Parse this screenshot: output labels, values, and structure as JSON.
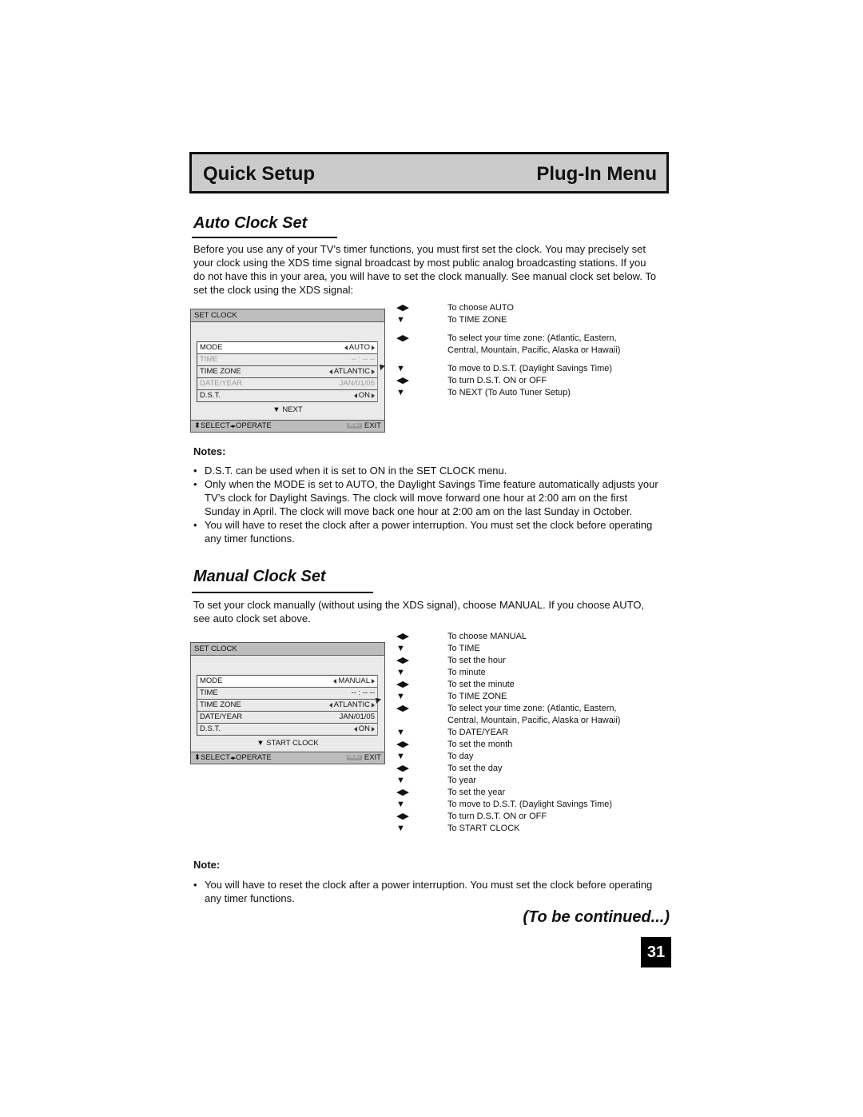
{
  "header": {
    "left_title": "Quick Setup",
    "right_title": "Plug-In Menu"
  },
  "auto_section": {
    "title": "Auto Clock Set",
    "intro": "Before you use any of your TV’s timer functions, you must first set the clock. You may precisely set your clock using the XDS time signal broadcast by most public analog broadcasting stations. If you do not have this in your area, you will have to set the clock manually. See manual clock set below. To set the clock using the XDS signal:",
    "menu": {
      "title": "SET CLOCK",
      "rows": [
        {
          "label": "MODE",
          "value": "AUTO",
          "arrows": true,
          "state": "highlight"
        },
        {
          "label": "TIME",
          "value": "-- : -- --",
          "arrows": false,
          "state": "dim"
        },
        {
          "label": "TIME ZONE",
          "value": "ATLANTIC",
          "arrows": true,
          "state": "normal"
        },
        {
          "label": "DATE/YEAR",
          "value": "JAN/01/05",
          "arrows": false,
          "state": "dim"
        },
        {
          "label": "D.S.T.",
          "value": "ON",
          "arrows": true,
          "state": "normal"
        }
      ],
      "next": "▼ NEXT",
      "footer_left": "SELECT",
      "footer_mid": "OPERATE",
      "footer_key": "MENU",
      "footer_right": "EXIT"
    },
    "instructions": [
      {
        "key": "◀▶",
        "text": "To choose AUTO"
      },
      {
        "key": "▼",
        "text": "To TIME ZONE",
        "gap_after": true
      },
      {
        "key": "◀▶",
        "text": "To select your time zone: (Atlantic, Eastern, Central, Mountain, Pacific, Alaska or Hawaii)",
        "gap_after": true
      },
      {
        "key": "▼",
        "text": "To move to D.S.T. (Daylight Savings Time)"
      },
      {
        "key": "◀▶",
        "text": "To turn D.S.T. ON or OFF"
      },
      {
        "key": "▼",
        "text": "To NEXT (To Auto Tuner Setup)"
      }
    ],
    "notes_label": "Notes:",
    "notes": [
      "D.S.T. can be used when it is set to ON in the SET CLOCK menu.",
      "Only when the MODE is set to AUTO, the Daylight Savings Time feature automatically adjusts your TV’s clock for Daylight Savings. The clock will move forward one hour at 2:00 am on the first Sunday in April. The clock will move back one hour at 2:00 am on the last Sunday in October.",
      "You will have to reset the clock after a power interruption. You must set the clock before operating any timer functions."
    ]
  },
  "manual_section": {
    "title": "Manual Clock Set",
    "intro": "To set your clock manually (without using the XDS signal), choose MANUAL. If you choose AUTO, see auto clock set above.",
    "menu": {
      "title": "SET CLOCK",
      "rows": [
        {
          "label": "MODE",
          "value": "MANUAL",
          "arrows": true,
          "state": "highlight"
        },
        {
          "label": "TIME",
          "value": "-- : -- --",
          "arrows": false,
          "state": "normal"
        },
        {
          "label": "TIME ZONE",
          "value": "ATLANTIC",
          "arrows": true,
          "state": "normal"
        },
        {
          "label": "DATE/YEAR",
          "value": "JAN/01/05",
          "arrows": false,
          "state": "normal"
        },
        {
          "label": "D.S.T.",
          "value": "ON",
          "arrows": true,
          "state": "normal"
        }
      ],
      "next": "▼ START CLOCK",
      "footer_left": "SELECT",
      "footer_mid": "OPERATE",
      "footer_key": "MENU",
      "footer_right": "EXIT"
    },
    "instructions": [
      {
        "key": "◀▶",
        "text": "To choose MANUAL"
      },
      {
        "key": "▼",
        "text": "To TIME"
      },
      {
        "key": "◀▶",
        "text": "To set the hour"
      },
      {
        "key": "▼",
        "text": "To minute"
      },
      {
        "key": "◀▶",
        "text": "To set the minute"
      },
      {
        "key": "▼",
        "text": "To TIME ZONE"
      },
      {
        "key": "◀▶",
        "text": "To select your time zone: (Atlantic, Eastern, Central, Mountain, Pacific, Alaska or Hawaii)"
      },
      {
        "key": "▼",
        "text": "To DATE/YEAR"
      },
      {
        "key": "◀▶",
        "text": "To set the month"
      },
      {
        "key": "▼",
        "text": "To day"
      },
      {
        "key": "◀▶",
        "text": "To set the day"
      },
      {
        "key": "▼",
        "text": "To year"
      },
      {
        "key": "◀▶",
        "text": "To set the year"
      },
      {
        "key": "▼",
        "text": "To move to D.S.T. (Daylight Savings Time)"
      },
      {
        "key": "◀▶",
        "text": "To turn D.S.T. ON or OFF"
      },
      {
        "key": "▼",
        "text": "To START CLOCK"
      }
    ],
    "notes_label": "Note:",
    "notes": [
      "You will have to reset the clock after a power interruption. You must set the clock before operating any timer functions."
    ]
  },
  "footer": {
    "continued": "(To be continued...)",
    "page_number": "31"
  }
}
